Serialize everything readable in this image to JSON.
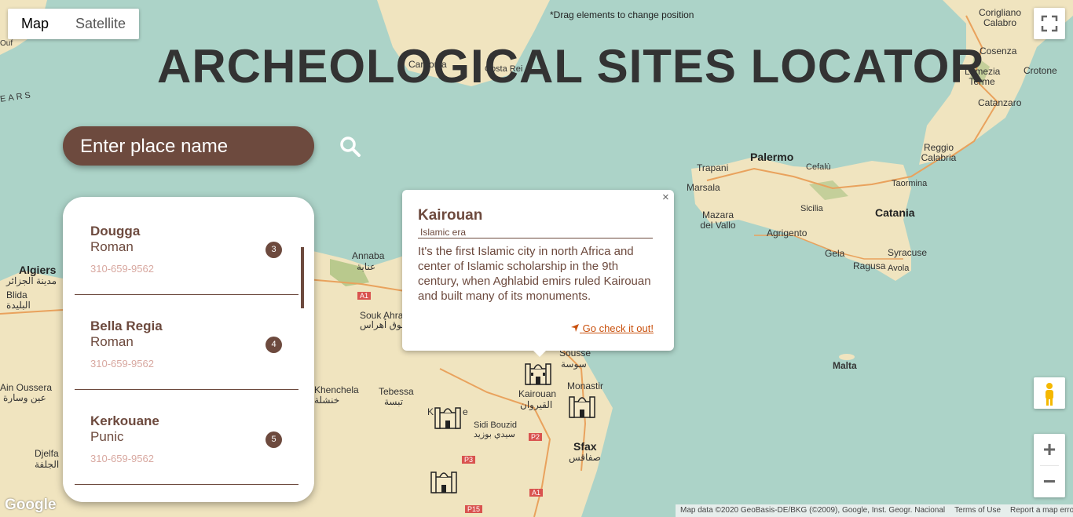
{
  "map_type": {
    "map": "Map",
    "satellite": "Satellite"
  },
  "drag_hint": "*Drag elements to change position",
  "title": "ARCHEOLOGICAL SITES LOCATOR",
  "search": {
    "placeholder": "Enter place name"
  },
  "sites": [
    {
      "name": "Dougga",
      "era": "Roman",
      "phone": "310-659-9562",
      "id": "3"
    },
    {
      "name": "Bella Regia",
      "era": "Roman",
      "phone": "310-659-9562",
      "id": "4"
    },
    {
      "name": "Kerkouane",
      "era": "Punic",
      "phone": "310-659-9562",
      "id": "5"
    }
  ],
  "popup": {
    "title": "Kairouan",
    "era": "Islamic era",
    "description": "It's the first Islamic city in north Africa and center of Islamic scholarship in the 9th century, when Aghlabid emirs ruled Kairouan and built many of its monuments.",
    "link": "Go check it out!",
    "close": "×"
  },
  "map_labels": {
    "palermo": "Palermo",
    "trapani": "Trapani",
    "marsala": "Marsala",
    "mazara": "Mazara del Vallo",
    "cefalu": "Cefalù",
    "taormina": "Taormina",
    "sicilia": "Sicilia",
    "catania": "Catania",
    "agrigento": "Agrigento",
    "gela": "Gela",
    "ragusa": "Ragusa",
    "avola": "Avola",
    "syracuse": "Syracuse",
    "malta": "Malta",
    "reggio": "Reggio Calabria",
    "catanzaro": "Catanzaro",
    "crotone": "Crotone",
    "cosenza": "Cosenza",
    "lamezia": "Lamezia Terme",
    "corigliano": "Corigliano Calabro",
    "algiers": "Algiers",
    "algiers_ar": "مدينة الجزائر",
    "blida": "Blida",
    "blida_ar": "البليدة",
    "ain_oussera": "Ain Oussera",
    "ain_oussera_ar": "عين وسارة",
    "djelfa": "Djelfa",
    "djelfa_ar": "الجلفة",
    "annaba": "Annaba",
    "annaba_ar": "عنابة",
    "souk_ahras": "Souk Ahras",
    "souk_ahras_ar": "سوق أهراس",
    "khenchela": "Khenchela",
    "khenchela_ar": "خنشلة",
    "tebessa": "Tebessa",
    "tebessa_ar": "تبسة",
    "kairouan": "Kairouan",
    "kairouan_ar": "القيروان",
    "sousse": "Sousse",
    "sousse_ar": "سوسة",
    "monastir": "Monastir",
    "sidi_bouzid": "Sidi Bouzid",
    "sidi_bouzid_ar": "سيدي بوزيد",
    "sfax": "Sfax",
    "sfax_ar": "صفاقس",
    "a1": "A1",
    "a1b": "A1",
    "p2": "P2",
    "p3": "P3",
    "p15": "P15",
    "carbonia": "Carbonia",
    "costa_rei": "Costa Rei",
    "ears": "EARS",
    "ouf": "Ouf",
    "kasserine": "K",
    "kasserine_tail": "e"
  },
  "attribution": {
    "data": "Map data ©2020 GeoBasis-DE/BKG (©2009), Google, Inst. Geogr. Nacional",
    "terms": "Terms of Use",
    "report": "Report a map error"
  },
  "google_logo": "Google",
  "controls": {
    "zoom_in": "+",
    "zoom_out": "−"
  },
  "colors": {
    "accent": "#6d4a3e",
    "sea": "#acd3c8",
    "land": "#f1e7c8",
    "link": "#c9500c"
  }
}
